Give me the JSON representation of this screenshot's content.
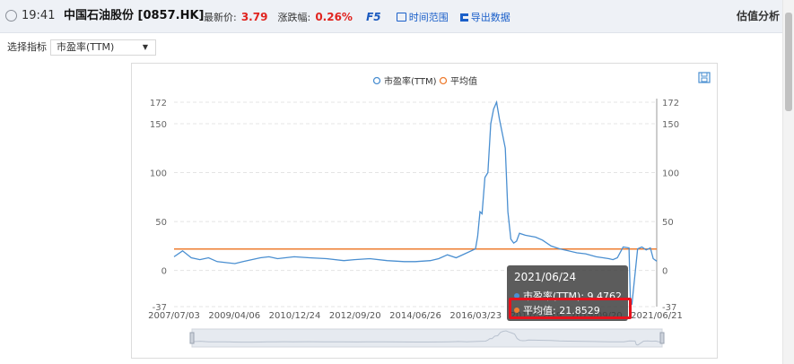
{
  "header": {
    "time": "19:41",
    "stock_name": "中国石油股份 [0857.HK]",
    "last_price_label": "最新价:",
    "last_price": "3.79",
    "change_label": "涨跌幅:",
    "change": "0.26%",
    "f5": "F5",
    "time_range": "时间范围",
    "export": "导出数据",
    "title_right": "估值分析"
  },
  "selector": {
    "label": "选择指标",
    "value": "市盈率(TTM)"
  },
  "colors": {
    "series": "#4a8fd1",
    "average": "#ee7d31",
    "highlight": "#e8121c",
    "price_red": "#e0241f"
  },
  "tooltip": {
    "date": "2021/06/24",
    "row1": "市盈率(TTM): 9.4762",
    "row2": "平均值: 21.8529"
  },
  "chart_data": {
    "type": "line",
    "legend": [
      "市盈率(TTM)",
      "平均值"
    ],
    "legend_placement": "top-center",
    "y_ticks": [
      -37,
      0,
      50,
      100,
      150,
      172
    ],
    "ylim": [
      -37,
      172
    ],
    "x_tick_labels": [
      "2007/07/03",
      "2009/04/06",
      "2010/12/24",
      "2012/09/20",
      "2014/06/26",
      "2016/03/23",
      "2017/12/19",
      "2019/09/20",
      "2021/06/21"
    ],
    "x_range": [
      "2007/07/03",
      "2021/06/21"
    ],
    "grid": true,
    "series": [
      {
        "name": "市盈率(TTM)",
        "x": [
          "2007/07/03",
          "2007/10/01",
          "2008/01/01",
          "2008/04/01",
          "2008/07/01",
          "2008/10/01",
          "2009/01/01",
          "2009/04/06",
          "2009/07/01",
          "2009/10/01",
          "2010/01/01",
          "2010/04/01",
          "2010/07/01",
          "2010/12/24",
          "2011/06/01",
          "2011/12/01",
          "2012/06/01",
          "2012/09/20",
          "2013/03/01",
          "2013/09/01",
          "2014/03/01",
          "2014/06/26",
          "2014/12/01",
          "2015/03/01",
          "2015/06/01",
          "2015/09/01",
          "2015/12/01",
          "2016/03/23",
          "2016/04/15",
          "2016/05/10",
          "2016/06/01",
          "2016/07/01",
          "2016/08/01",
          "2016/09/01",
          "2016/10/01",
          "2016/11/01",
          "2016/12/01",
          "2017/01/01",
          "2017/02/01",
          "2017/03/01",
          "2017/04/01",
          "2017/05/01",
          "2017/06/01",
          "2017/07/01",
          "2017/09/01",
          "2017/12/19",
          "2018/03/01",
          "2018/06/01",
          "2018/09/01",
          "2018/12/01",
          "2019/03/01",
          "2019/06/01",
          "2019/09/20",
          "2019/12/01",
          "2020/02/01",
          "2020/03/15",
          "2020/05/01",
          "2020/07/01",
          "2020/09/01",
          "2020/09/15",
          "2020/10/01",
          "2020/12/01",
          "2021/01/15",
          "2021/03/01",
          "2021/04/15",
          "2021/05/15",
          "2021/06/21"
        ],
        "values": [
          14,
          20,
          13,
          11,
          13,
          9,
          8,
          7,
          9,
          11,
          13,
          14,
          12,
          14,
          13,
          12,
          10,
          11,
          12,
          10,
          9,
          9,
          10,
          12,
          16,
          13,
          17,
          22,
          35,
          60,
          58,
          95,
          100,
          150,
          165,
          172,
          155,
          140,
          125,
          60,
          32,
          28,
          30,
          38,
          36,
          34,
          31,
          25,
          22,
          20,
          18,
          17,
          14,
          13,
          12,
          11,
          13,
          24,
          23,
          -30,
          -35,
          22,
          24,
          21,
          23,
          12,
          9.4762
        ]
      },
      {
        "name": "平均值",
        "value": 21.8529
      }
    ]
  }
}
